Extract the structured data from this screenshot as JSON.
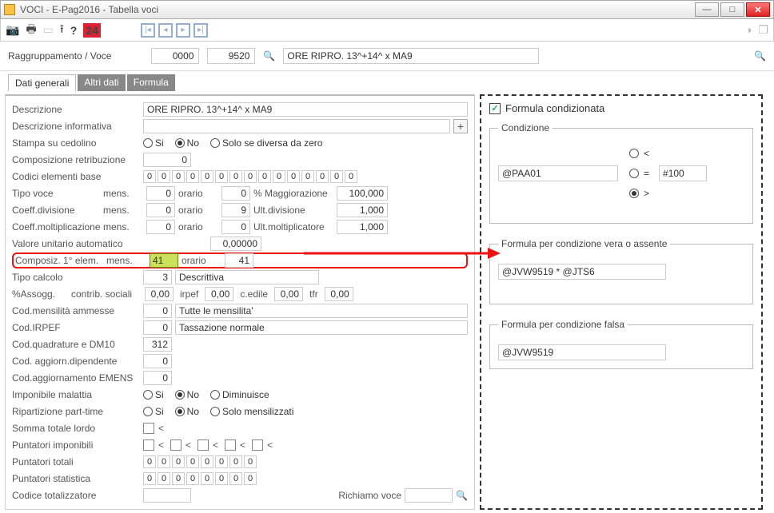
{
  "window": {
    "title": "VOCI  - E-Pag2016  -  Tabella voci"
  },
  "toolbar": {
    "badge": "24"
  },
  "filter": {
    "label": "Raggruppamento / Voce",
    "code1": "0000",
    "code2": "9520",
    "desc": "ORE RIPRO. 13^+14^ x MA9"
  },
  "tabs": [
    "Dati generali",
    "Altri dati",
    "Formula"
  ],
  "left": {
    "descrizione_label": "Descrizione",
    "descrizione_val": "ORE RIPRO. 13^+14^ x MA9",
    "descr_info_label": "Descrizione informativa",
    "stampa_label": "Stampa su cedolino",
    "opt_si": "Si",
    "opt_no": "No",
    "opt_div": "Solo se diversa da zero",
    "comp_retrib_label": "Composizione retribuzione",
    "comp_retrib_val": "0",
    "codici_base_label": "Codici elementi base",
    "codici_base": [
      "0",
      "0",
      "0",
      "0",
      "0",
      "0",
      "0",
      "0",
      "0",
      "0",
      "0",
      "0",
      "0",
      "0",
      "0"
    ],
    "tipo_voce_label": "Tipo voce",
    "mens": "mens.",
    "orario": "orario",
    "pct_magg": "% Maggiorazione",
    "tv_m": "0",
    "tv_o": "0",
    "tv_pct": "100,000",
    "coeff_div_label": "Coeff.divisione",
    "cd_m": "0",
    "cd_o": "9",
    "ult_div": "Ult.divisione",
    "cd_u": "1,000",
    "coeff_mol_label": "Coeff.moltiplicazione",
    "cm_m": "0",
    "cm_o": "0",
    "ult_mol": "Ult.moltiplicatore",
    "cm_u": "1,000",
    "val_unit_label": "Valore unitario automatico",
    "val_unit": "0,00000",
    "compos_label": "Composiz. 1° elem.",
    "compos_m": "41",
    "compos_o": "41",
    "tipo_calc_label": "Tipo calcolo",
    "tipo_calc": "3",
    "tipo_calc_desc": "Descrittiva",
    "pct_assogg_label": "%Assogg.",
    "contrib": "contrib. sociali",
    "pa_cs": "0,00",
    "irpef": "irpef",
    "pa_ir": "0,00",
    "cedile": "c.edile",
    "pa_ce": "0,00",
    "tfr": "tfr",
    "pa_tfr": "0,00",
    "cod_mens_label": "Cod.mensilità ammesse",
    "cod_mens": "0",
    "cod_mens_desc": "Tutte le mensilita'",
    "cod_irpef_label": "Cod.IRPEF",
    "cod_irpef": "0",
    "cod_irpef_desc": "Tassazione normale",
    "cod_quadr_label": "Cod.quadrature e DM10",
    "cod_quadr": "312",
    "cod_agg_dip_label": "Cod. aggiorn.dipendente",
    "cod_agg_dip": "0",
    "cod_agg_emens_label": "Cod.aggiornamento EMENS",
    "cod_agg_emens": "0",
    "imp_mal_label": "Imponibile malattia",
    "opt_dim": "Diminuisce",
    "rip_pt_label": "Ripartizione part-time",
    "opt_mens": "Solo mensilizzati",
    "somma_label": "Somma totale lordo",
    "punt_imp_label": "Puntatori imponibili",
    "punt_tot_label": "Puntatori totali",
    "pt_digits": [
      "0",
      "0",
      "0",
      "0",
      "0",
      "0",
      "0",
      "0"
    ],
    "punt_stat_label": "Puntatori statistica",
    "ps_digits": [
      "0",
      "0",
      "0",
      "0",
      "0",
      "0",
      "0",
      "0"
    ],
    "cod_tot_label": "Codice totalizzatore",
    "richiamo": "Richiamo voce"
  },
  "right": {
    "cond_chk_label": "Formula condizionata",
    "cond_legend": "Condizione",
    "cond_input": "@PAA01",
    "op_lt": "<",
    "op_eq": "=",
    "op_gt": ">",
    "cond_val": "#100",
    "vera_legend": "Formula per condizione vera o assente",
    "vera_val": "@JVW9519 * @JTS6",
    "falsa_legend": "Formula per condizione falsa",
    "falsa_val": "@JVW9519"
  }
}
